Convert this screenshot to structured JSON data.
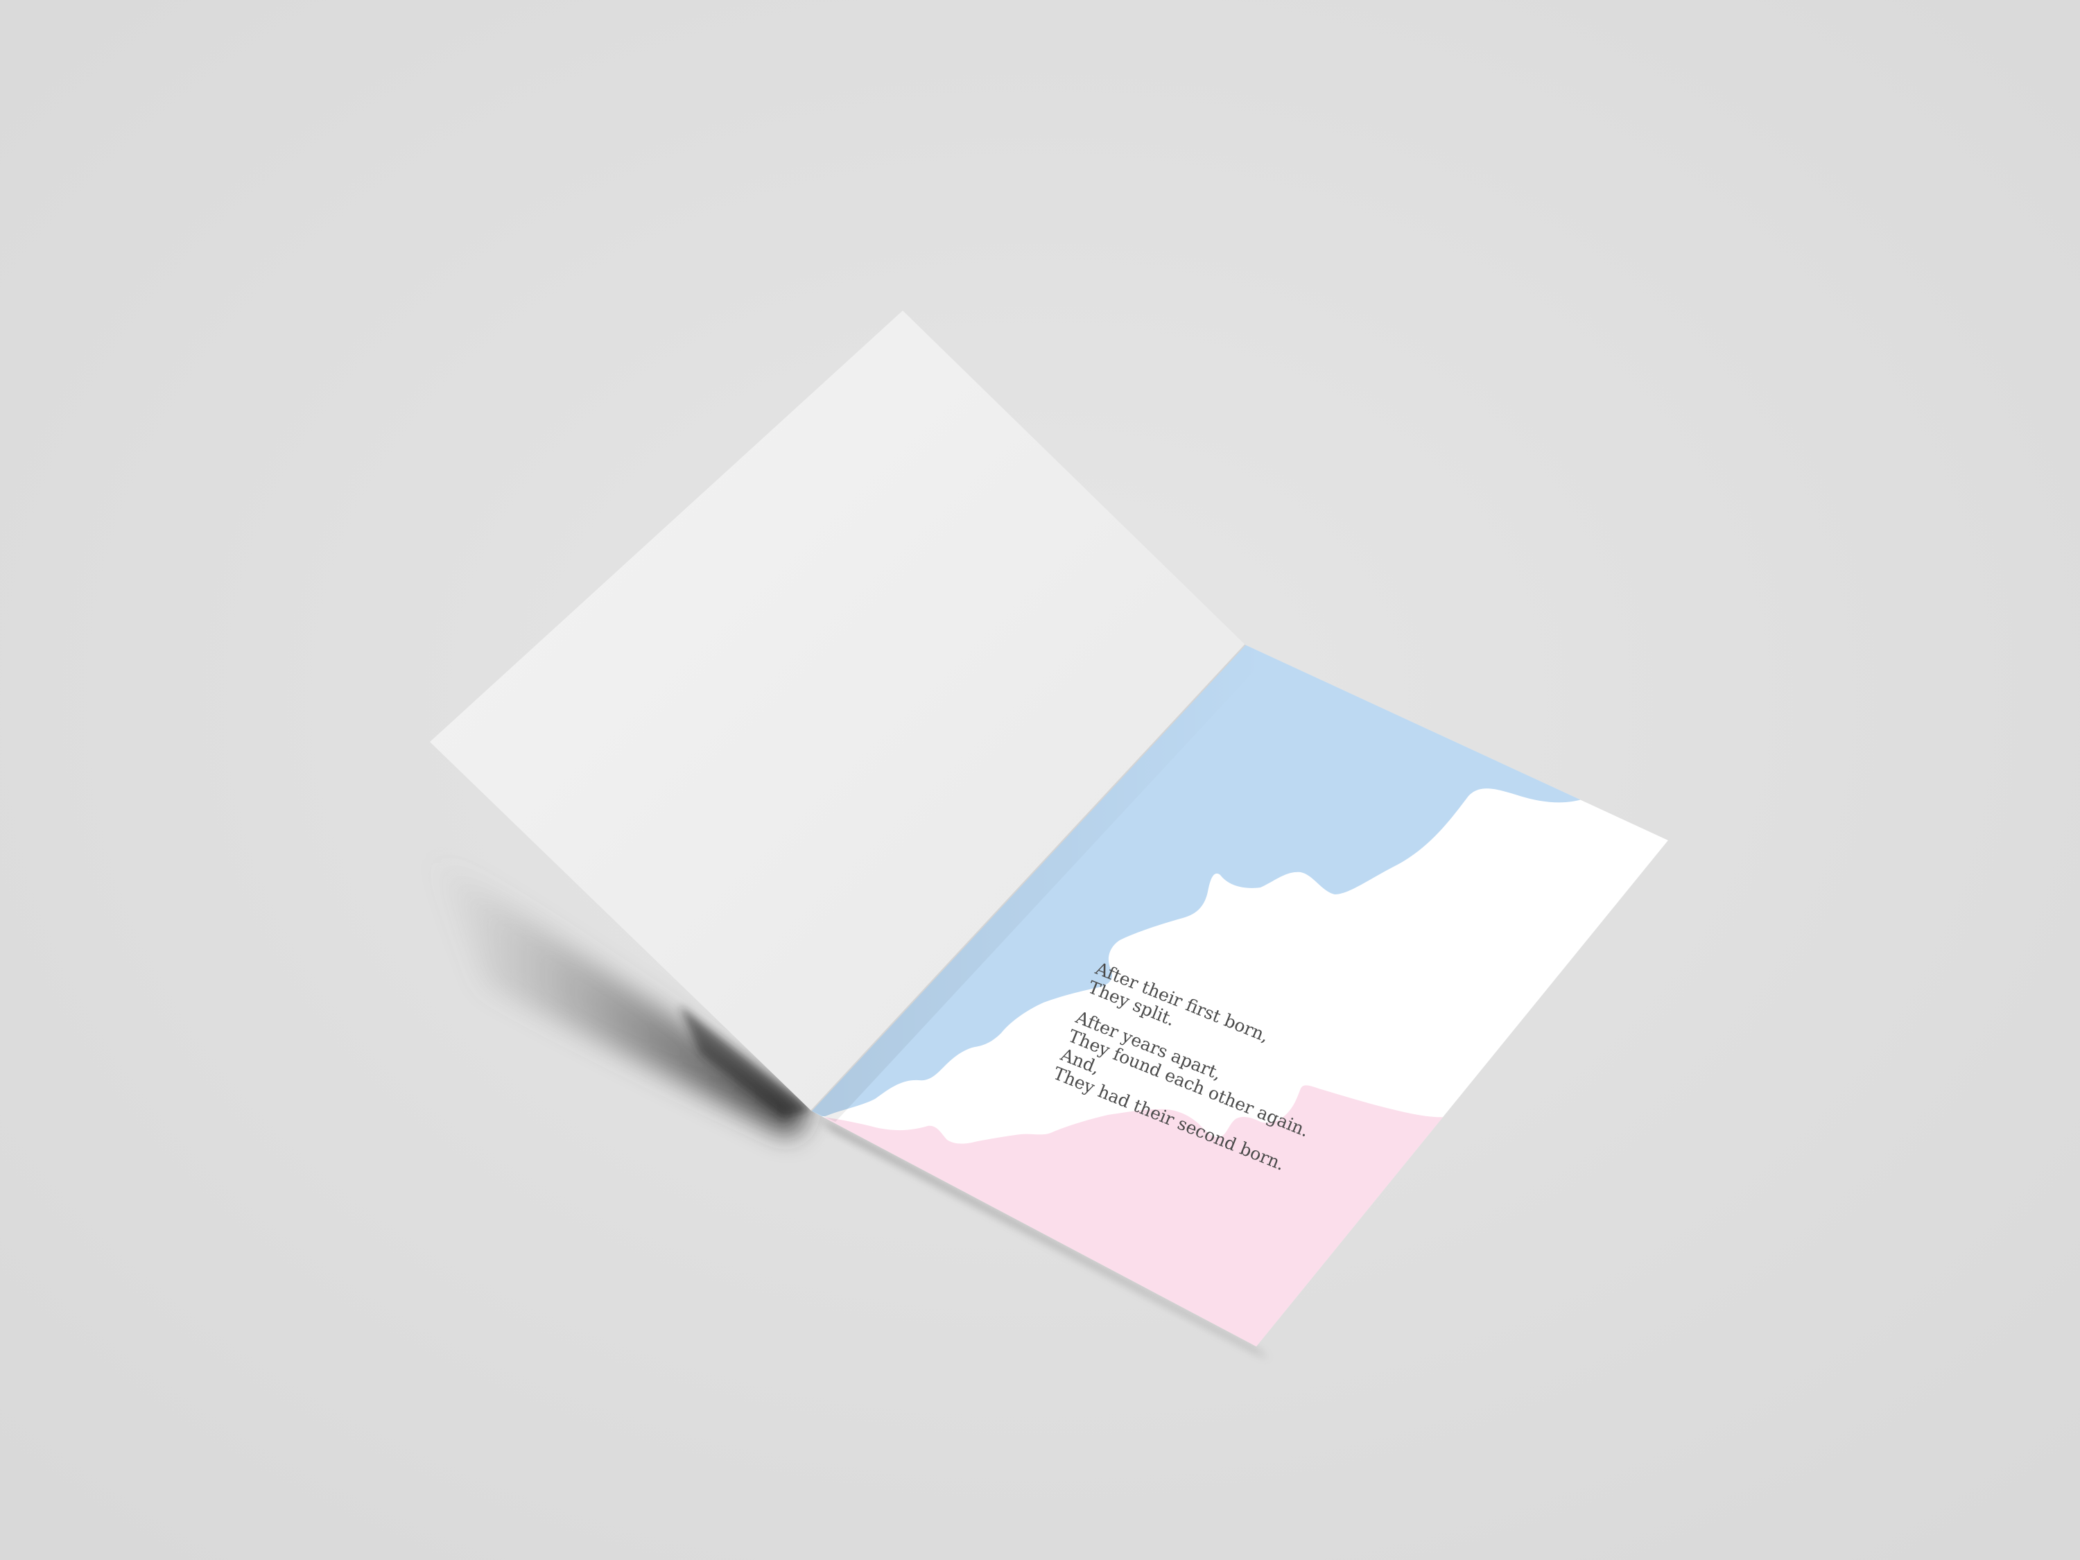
{
  "scene": {
    "background_color": "#dedede",
    "left_panel_color": "#efefef",
    "right_panel_color": "#ffffff",
    "blue_wave_color": "#bdd9f2",
    "pink_wave_color": "#fbdeeb",
    "text_color": "#4a4a4a"
  },
  "poem": {
    "stanza1": {
      "line1": "After their first born,",
      "line2": "They split."
    },
    "stanza2": {
      "line1": "After years apart,",
      "line2": "They found each other again.",
      "line3": "And,",
      "line4": "They had their second born."
    }
  }
}
